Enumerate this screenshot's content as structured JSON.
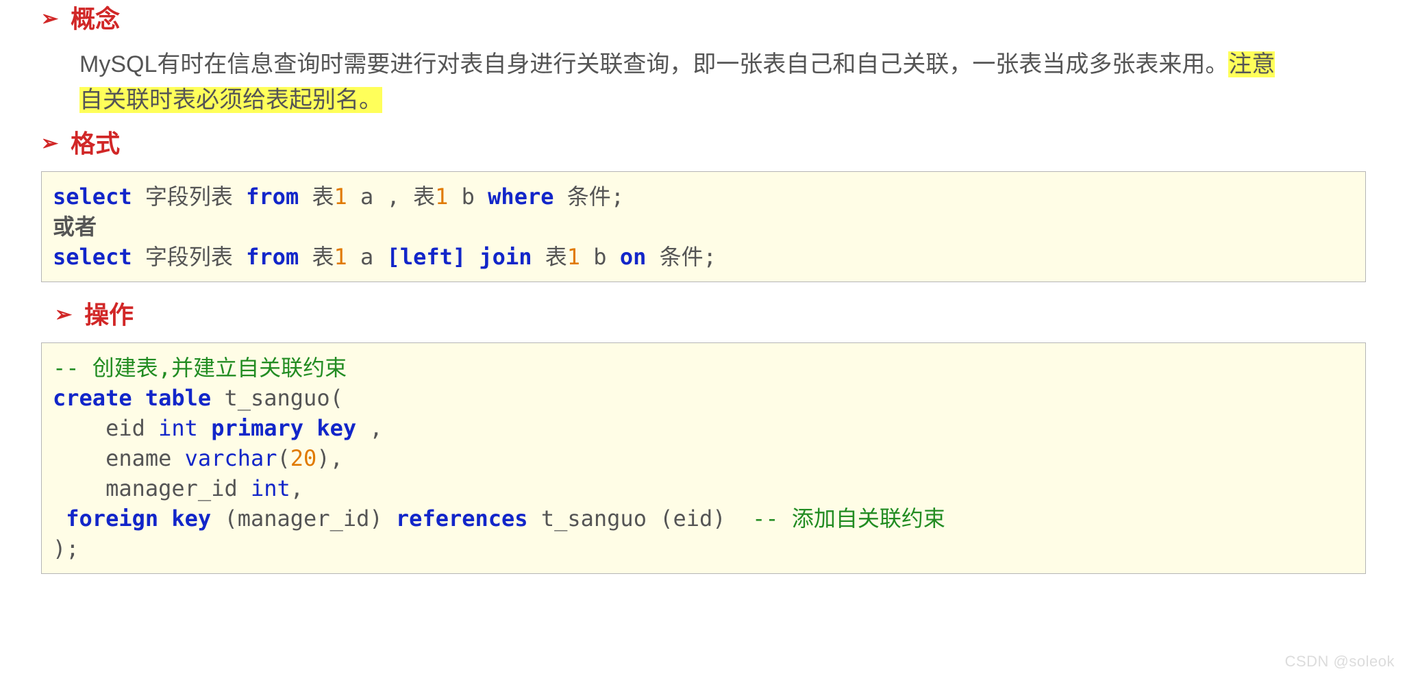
{
  "sections": {
    "s1": {
      "arrow": "➢",
      "heading": "概念"
    },
    "s2": {
      "arrow": "➢",
      "heading": "格式"
    },
    "s3": {
      "arrow": "➢",
      "heading": "操作"
    }
  },
  "body": {
    "text_prefix": "MySQL有时在信息查询时需要进行对表自身进行关联查询，即一张表自己和自己关联，一张表当成多张表来用。",
    "text_highlight": "注意自关联时表必须给表起别名。"
  },
  "code1": {
    "select1": "select",
    "fieldlist": " 字段列表 ",
    "from1": "from",
    "table1": " 表",
    "one1": "1",
    "a": " a , ",
    "table1b": "表",
    "one1b": "1",
    "b": " b ",
    "where": "where",
    "cond": " 条件;",
    "or": "或者",
    "select2": "select",
    "fieldlist2": " 字段列表 ",
    "from2": "from",
    "table2": " 表",
    "one2": "1",
    "a2": " a ",
    "leftbracket": "[left]",
    "join": " join ",
    "table2b": "表",
    "one2b": "1",
    "b2": " b ",
    "on": "on",
    "cond2": " 条件;"
  },
  "code2": {
    "cmt1": "-- 创建表,并建立自关联约束",
    "create": "create",
    "sp1": " ",
    "table": "table",
    "name": " t_sanguo(",
    "line_eid_pre": "    eid ",
    "int1": "int",
    "sp2": " ",
    "primary": "primary",
    "sp3": " ",
    "key1": "key",
    "after_pk": " ,",
    "line_ename_pre": "    ename ",
    "varchar": "varchar",
    "paren_l": "(",
    "twenty": "20",
    "paren_r_comma": "),",
    "line_mgr_pre": "    manager_id ",
    "int2": "int",
    "comma2": ",",
    "foreign_pre": " ",
    "foreign": "foreign",
    "sp4": " ",
    "key2": "key",
    "fk_rest1": " (manager_id) ",
    "references": "references",
    "fk_rest2": " t_sanguo (eid)  ",
    "cmt2": "-- 添加自关联约束",
    "close": ");"
  },
  "watermark": "CSDN @soleok"
}
